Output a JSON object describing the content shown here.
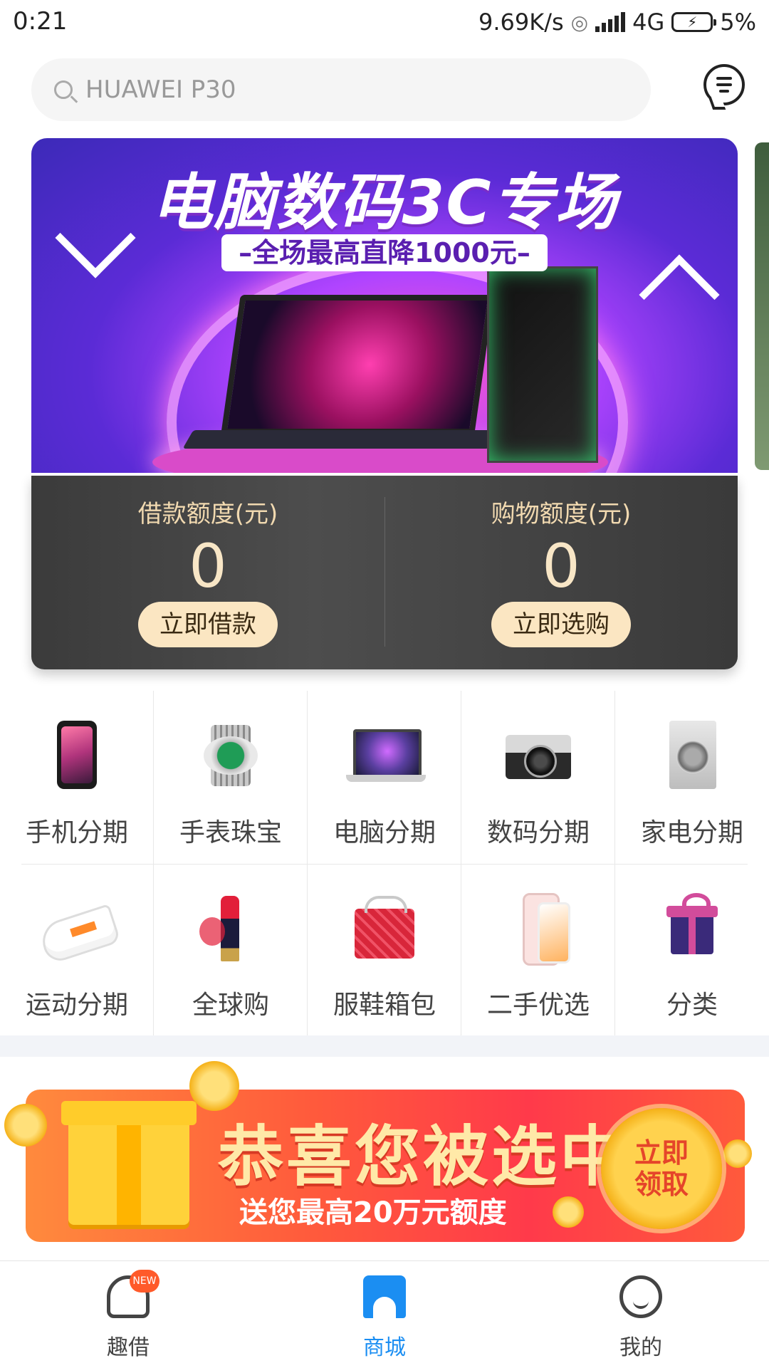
{
  "status_bar": {
    "time": "0:21",
    "net_speed": "9.69K/s",
    "network": "4G",
    "battery": "5%"
  },
  "search": {
    "placeholder": "HUAWEI P30"
  },
  "banner": {
    "title": "电脑数码3C专场",
    "subtitle": "–全场最高直降1000元–"
  },
  "credit": {
    "loan": {
      "label": "借款额度(元)",
      "value": "0",
      "button": "立即借款"
    },
    "shopping": {
      "label": "购物额度(元)",
      "value": "0",
      "button": "立即选购"
    }
  },
  "categories": [
    {
      "label": "手机分期",
      "icon": "phone-icon"
    },
    {
      "label": "手表珠宝",
      "icon": "watch-icon"
    },
    {
      "label": "电脑分期",
      "icon": "laptop-icon"
    },
    {
      "label": "数码分期",
      "icon": "camera-icon"
    },
    {
      "label": "家电分期",
      "icon": "washer-icon"
    },
    {
      "label": "运动分期",
      "icon": "sneaker-icon"
    },
    {
      "label": "全球购",
      "icon": "lipstick-icon"
    },
    {
      "label": "服鞋箱包",
      "icon": "handbag-icon"
    },
    {
      "label": "二手优选",
      "icon": "iphone-icon"
    },
    {
      "label": "分类",
      "icon": "gift-icon"
    }
  ],
  "promo": {
    "title": "恭喜您被选中!",
    "subtitle": "送您最高20万元额度",
    "button": "立即领取"
  },
  "tabbar": {
    "items": [
      {
        "label": "趣借",
        "badge": "NEW",
        "active": false
      },
      {
        "label": "商城",
        "active": true
      },
      {
        "label": "我的",
        "active": false
      }
    ],
    "active_color": "#1b8ef2",
    "inactive_color": "#444444"
  }
}
